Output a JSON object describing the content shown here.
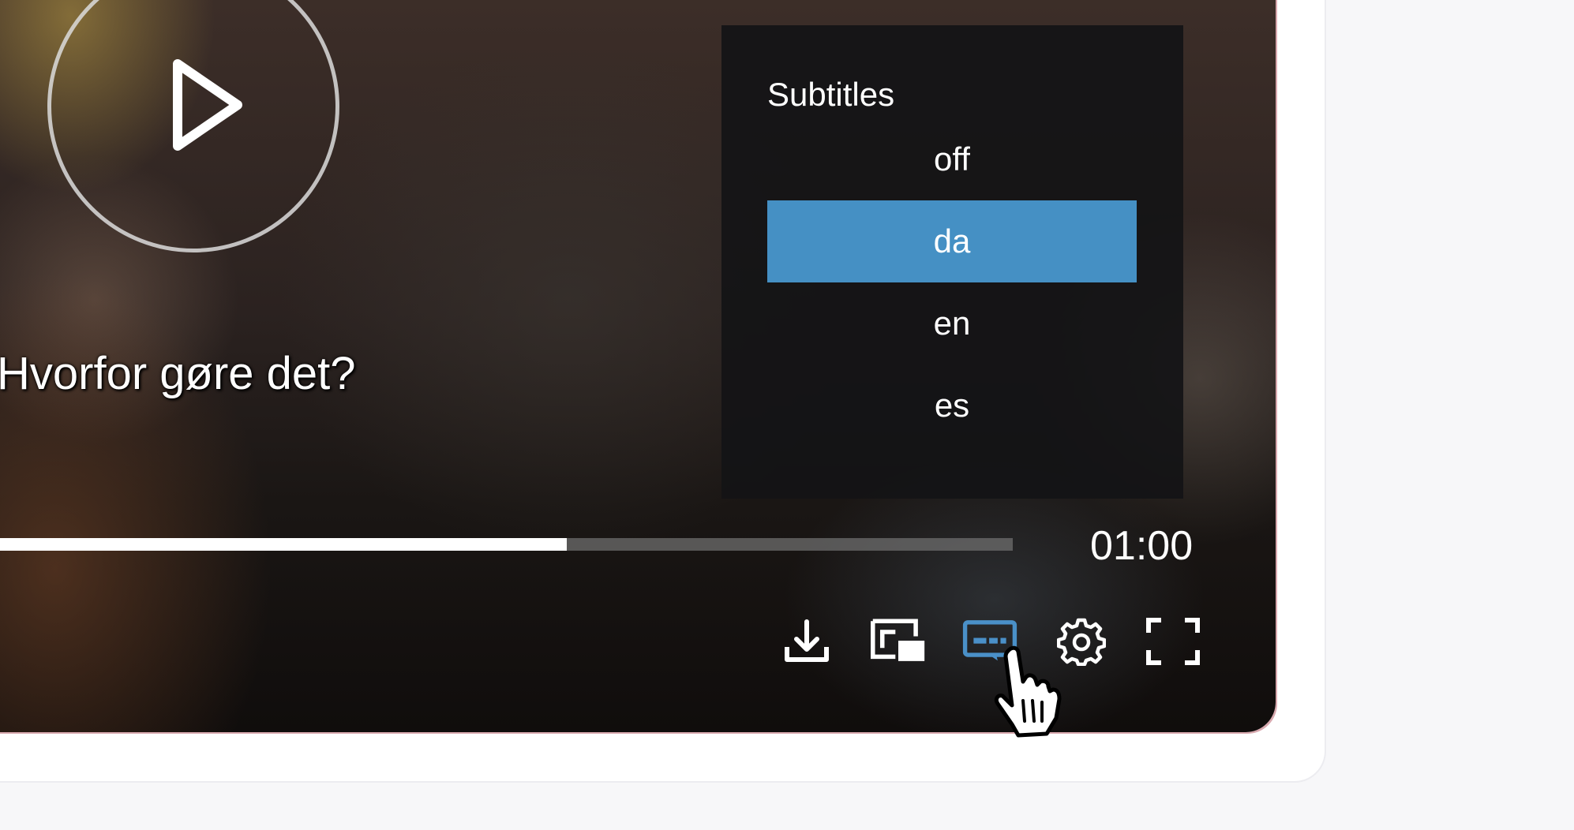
{
  "player": {
    "subtitle_text": "Hvorfor gøre det?",
    "progress": 0.56,
    "time": "01:00"
  },
  "subtitles_menu": {
    "title": "Subtitles",
    "options": [
      "off",
      "da",
      "en",
      "es"
    ],
    "selected": "da"
  },
  "controls": {
    "icons": [
      "download-icon",
      "picture-in-picture-icon",
      "subtitles-icon",
      "gear-icon",
      "fullscreen-icon"
    ],
    "active_color": "#4a90c8"
  },
  "colors": {
    "menu_selected": "#4590c4",
    "progress_played": "#ffffff",
    "progress_track": "#6e6e6e"
  }
}
